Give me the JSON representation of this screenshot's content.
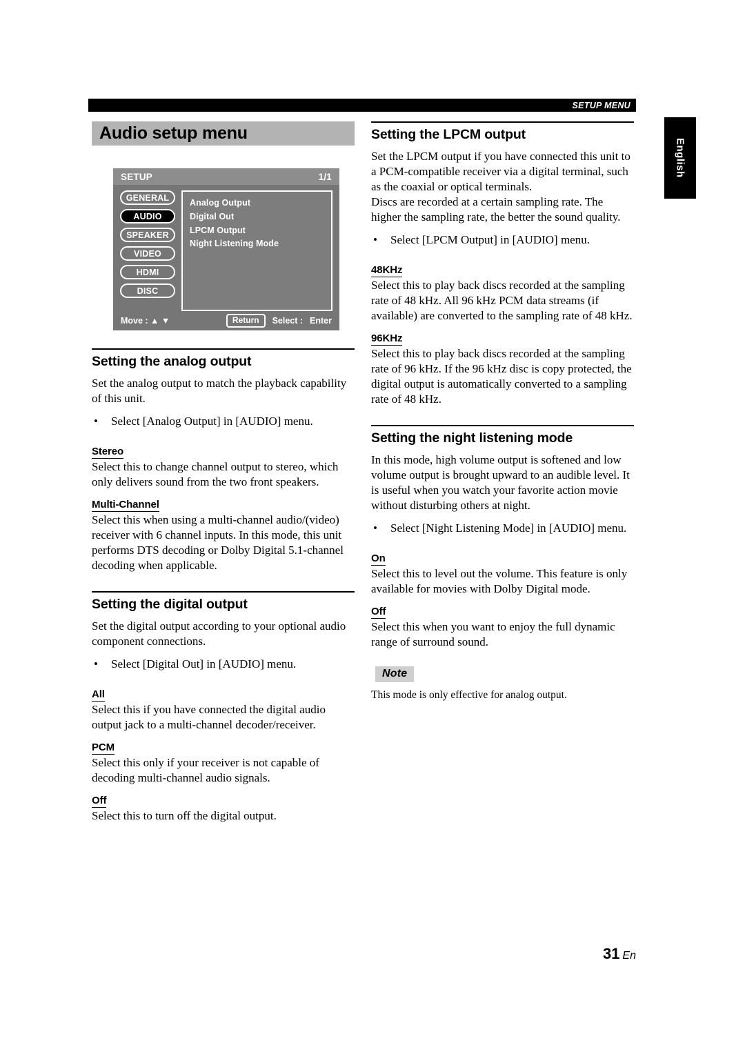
{
  "running_head": {
    "label": "SETUP MENU"
  },
  "language_tab": {
    "label": "English"
  },
  "chapter": {
    "title": "Audio setup menu"
  },
  "osd": {
    "title": "SETUP",
    "page_indicator": "1/1",
    "nav_buttons": [
      {
        "label": "GENERAL",
        "active": false
      },
      {
        "label": "AUDIO",
        "active": true
      },
      {
        "label": "SPEAKER",
        "active": false
      },
      {
        "label": "VIDEO",
        "active": false
      },
      {
        "label": "HDMI",
        "active": false
      },
      {
        "label": "DISC",
        "active": false
      }
    ],
    "menu_items": [
      "Analog Output",
      "Digital Out",
      "LPCM Output",
      "Night Listening Mode"
    ],
    "footer": {
      "move_label": "Move :  ▲ ▼",
      "return_key": "Return",
      "select_label": "Select :",
      "enter_label": "Enter"
    }
  },
  "sections": {
    "analog": {
      "heading": "Setting the analog output",
      "intro": "Set the analog output to match the playback capability of this unit.",
      "bullet_dot": "•",
      "bullet": "Select [Analog Output] in [AUDIO] menu.",
      "options": [
        {
          "term": "Stereo",
          "text": "Select this to change channel output to stereo, which only delivers sound from the two front speakers."
        },
        {
          "term": "Multi-Channel",
          "text": "Select this when using a multi-channel audio/(video) receiver with 6 channel inputs. In this mode, this unit performs DTS decoding or Dolby Digital 5.1-channel decoding when applicable."
        }
      ]
    },
    "digital": {
      "heading": "Setting the digital output",
      "intro": "Set the digital output according to your optional audio component connections.",
      "bullet_dot": "•",
      "bullet": "Select [Digital Out] in [AUDIO] menu.",
      "options": [
        {
          "term": "All",
          "text": "Select this if you have connected the digital audio output jack to a multi-channel decoder/receiver."
        },
        {
          "term": "PCM",
          "text": "Select this only if your receiver is not capable of decoding multi-channel audio signals."
        },
        {
          "term": "Off",
          "text": "Select this to turn off the digital output."
        }
      ]
    },
    "lpcm": {
      "heading": "Setting the LPCM output",
      "intro": "Set the LPCM output if you have connected this unit to a PCM-compatible receiver via a digital terminal, such as the coaxial or optical terminals.",
      "intro2": "Discs are recorded at a certain sampling rate. The higher the sampling rate, the better the sound quality.",
      "bullet_dot": "•",
      "bullet": "Select [LPCM Output] in [AUDIO] menu.",
      "options": [
        {
          "term": "48KHz",
          "text": "Select this to play back discs recorded at the sampling rate of 48 kHz. All 96 kHz PCM data streams (if available) are converted to the sampling rate of 48 kHz."
        },
        {
          "term": "96KHz",
          "text": "Select this to play back discs recorded at the sampling rate of 96 kHz. If the 96 kHz disc is copy protected, the digital output is automatically converted to a sampling rate of 48 kHz."
        }
      ]
    },
    "night": {
      "heading": "Setting the night listening mode",
      "intro": "In this mode, high volume output is softened and low volume output is brought upward to an audible level. It is useful when you watch your favorite action movie without disturbing others at night.",
      "bullet_dot": "•",
      "bullet": "Select [Night Listening Mode] in [AUDIO] menu.",
      "options": [
        {
          "term": "On",
          "text": "Select this to level out the volume. This feature is only available for movies with Dolby Digital mode."
        },
        {
          "term": "Off",
          "text": "Select this when you want to enjoy the full dynamic range of surround sound."
        }
      ],
      "note_badge": "Note",
      "note_text": "This mode is only effective for analog output."
    }
  },
  "folio": {
    "number": "31",
    "lang": "En"
  }
}
